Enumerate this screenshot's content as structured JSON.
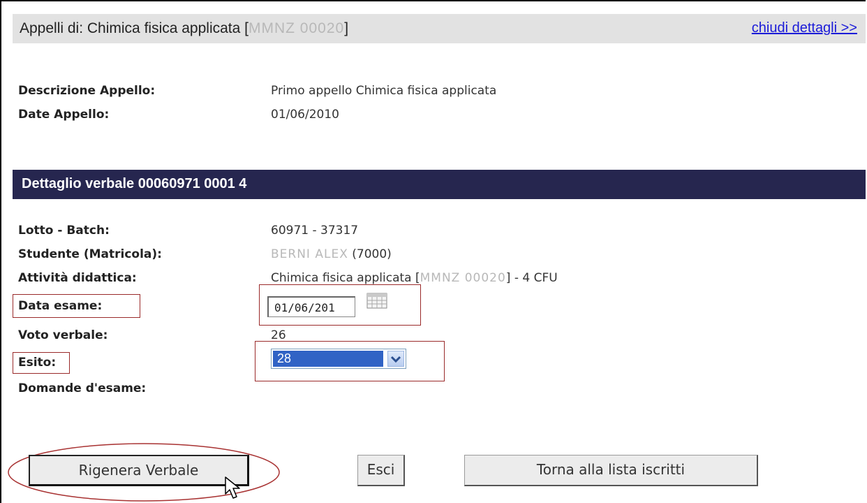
{
  "header": {
    "title_prefix": "Appelli di: Chimica fisica applicata [",
    "course_code": "MMNZ 00020",
    "title_suffix": "]",
    "close_link": "chiudi dettagli >>"
  },
  "appello": {
    "descrizione_label": "Descrizione Appello:",
    "descrizione_value": "Primo appello Chimica fisica applicata",
    "date_label": "Date Appello:",
    "date_value": "01/06/2010"
  },
  "section": {
    "title": "Dettaglio verbale 00060971 0001 4"
  },
  "details": {
    "lotto_label": "Lotto - Batch:",
    "lotto_value": "60971 - 37317",
    "studente_label": "Studente (Matricola):",
    "studente_name": "BERNI ALEX",
    "studente_matricola": "(7000)",
    "attivita_label": "Attività didattica:",
    "attivita_prefix": "Chimica fisica applicata [",
    "attivita_code": "MMNZ 00020",
    "attivita_suffix": "] - 4 CFU",
    "data_esame_label": "Data esame:",
    "data_esame_value": "01/06/201",
    "voto_label": "Voto verbale:",
    "voto_value": "26",
    "esito_label": "Esito:",
    "esito_value": "28",
    "domande_label": "Domande d'esame:"
  },
  "buttons": {
    "regenerate": "Rigenera Verbale",
    "exit": "Esci",
    "back": "Torna alla lista iscritti"
  },
  "icons": {
    "calendar": "calendar-icon",
    "dropdown": "chevron-down-icon",
    "cursor": "mouse-pointer-icon"
  },
  "colors": {
    "section_bar": "#26264f",
    "header_bar": "#e2e2e2",
    "link": "#1b1bd8",
    "highlight": "#9a2a2a",
    "selected": "#3163c5"
  }
}
